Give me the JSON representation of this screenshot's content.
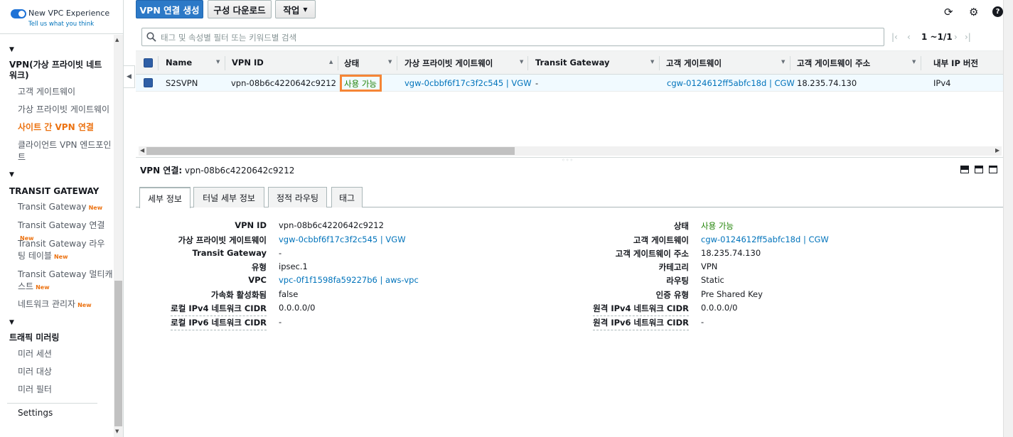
{
  "sidebar": {
    "experience_title": "New VPC Experience",
    "experience_sub": "Tell us what you think",
    "sections": {
      "vpn": "VPN(가상 프라이빗 네트워크)",
      "tgw": "TRANSIT GATEWAY",
      "mirror": "트래픽 미러링"
    },
    "vpn_items": [
      "고객 게이트웨이",
      "가상 프라이빗 게이트웨이",
      "사이트 간 VPN 연결",
      "클라이언트 VPN 엔드포인트"
    ],
    "tgw_items": [
      "Transit Gateway",
      "Transit Gateway 연결",
      "Transit Gateway 라우팅 테이블",
      "Transit Gateway 멀티캐스트",
      "네트워크 관리자"
    ],
    "new_badge": "New",
    "mirror_items": [
      "미러 세션",
      "미러 대상",
      "미러 필터"
    ],
    "settings": "Settings"
  },
  "toolbar": {
    "create_label": "VPN 연결 생성",
    "download_label": "구성 다운로드",
    "actions_label": "작업"
  },
  "search": {
    "placeholder": "태그 및 속성별 필터 또는 키워드별 검색"
  },
  "pager": {
    "text": "1 ~1/1"
  },
  "table": {
    "headers": [
      "Name",
      "VPN ID",
      "상태",
      "가상 프라이빗 게이트웨이",
      "Transit Gateway",
      "고객 게이트웨이",
      "고객 게이트웨이 주소",
      "내부 IP 버전"
    ],
    "row": {
      "name": "S2SVPN",
      "vpn_id": "vpn-08b6c4220642c9212",
      "state": "사용 가능",
      "vgw": "vgw-0cbbf6f17c3f2c545 | VGW",
      "tgw": "-",
      "cgw": "cgw-0124612ff5abfc18d | CGW",
      "cgw_addr": "18.235.74.130",
      "ip_ver": "IPv4"
    }
  },
  "details": {
    "title_label": "VPN 연결:",
    "title_value": "vpn-08b6c4220642c9212",
    "tabs": [
      "세부 정보",
      "터널 세부 정보",
      "정적 라우팅",
      "태그"
    ],
    "left": [
      {
        "k": "VPN ID",
        "v": "vpn-08b6c4220642c9212"
      },
      {
        "k": "가상 프라이빗 게이트웨이",
        "v": "vgw-0cbbf6f17c3f2c545 | VGW"
      },
      {
        "k": "Transit Gateway",
        "v": "-"
      },
      {
        "k": "유형",
        "v": "ipsec.1"
      },
      {
        "k": "VPC",
        "v": "vpc-0f1f1598fa59227b6 | aws-vpc"
      },
      {
        "k": "가속화 활성화됨",
        "v": "false"
      },
      {
        "k": "로컬 IPv4 네트워크 CIDR",
        "v": "0.0.0.0/0"
      },
      {
        "k": "로컬 IPv6 네트워크 CIDR",
        "v": "-"
      }
    ],
    "right": [
      {
        "k": "상태",
        "v": "사용 가능"
      },
      {
        "k": "고객 게이트웨이",
        "v": "cgw-0124612ff5abfc18d | CGW"
      },
      {
        "k": "고객 게이트웨이 주소",
        "v": "18.235.74.130"
      },
      {
        "k": "카테고리",
        "v": "VPN"
      },
      {
        "k": "라우팅",
        "v": "Static"
      },
      {
        "k": "인증 유형",
        "v": "Pre Shared Key"
      },
      {
        "k": "원격 IPv4 네트워크 CIDR",
        "v": "0.0.0.0/0"
      },
      {
        "k": "원격 IPv6 네트워크 CIDR",
        "v": "-"
      }
    ]
  },
  "colors": {
    "primary": "#2c79c7",
    "active_nav": "#ec7211",
    "status_ok": "#1d8102",
    "link": "#0073bb",
    "highlight": "#f58536"
  }
}
